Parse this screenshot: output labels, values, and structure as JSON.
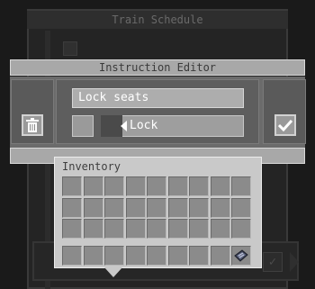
{
  "background": {
    "title": "Train Schedule",
    "confirm_icon": "check-icon"
  },
  "instruction_editor": {
    "title": "Instruction Editor",
    "delete_icon": "trash-icon",
    "confirm_icon": "check-icon",
    "text_input": {
      "value": "Lock seats"
    },
    "action_dropdown": {
      "selected": "Lock"
    }
  },
  "inventory": {
    "title": "Inventory",
    "rows": 3,
    "columns": 9,
    "hotbar": 9,
    "item_icon": "schedule-item-icon"
  }
}
